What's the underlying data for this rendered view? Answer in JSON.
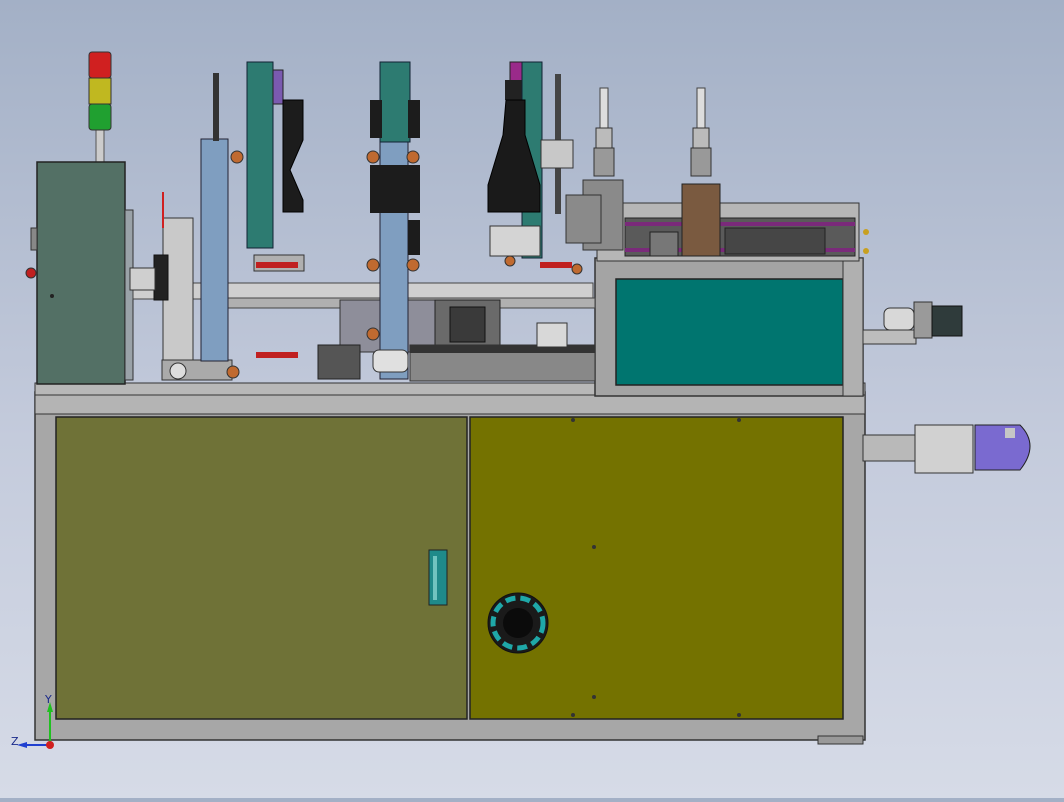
{
  "viewport": {
    "background_top": "#a3b0c6",
    "background_bottom": "#d6dbe7"
  },
  "triad": {
    "z_label": "Z",
    "y_label": "Y"
  },
  "colors": {
    "frame": "#a7a7a7",
    "cabinet_left": "#6f7237",
    "cabinet_right": "#747200",
    "control_box": "#537065",
    "guard_panel": "#00756f",
    "blue_plate": "#7f9ec0",
    "teal_plate": "#2d7b71",
    "purple_part": "#7a5ab0",
    "magenta_part": "#9a2a8a",
    "copper_knob": "#c06a30",
    "signal_red": "#d02020",
    "signal_yellow": "#c0b820",
    "signal_green": "#20a030"
  }
}
